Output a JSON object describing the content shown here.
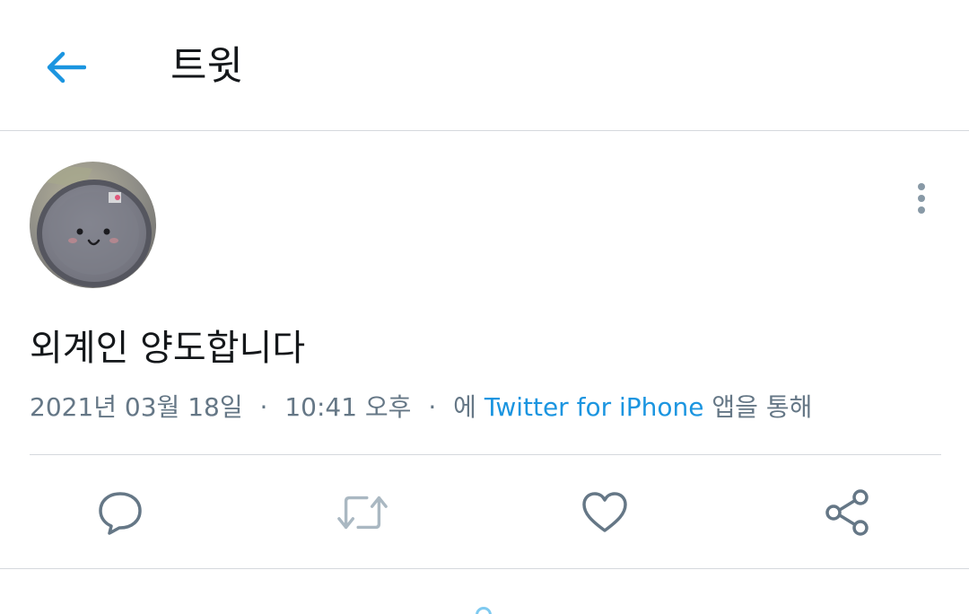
{
  "header": {
    "title": "트윗",
    "back_icon": "arrow-left-icon"
  },
  "author": {
    "avatar": "profile-avatar",
    "more_icon": "vertical-dots-icon"
  },
  "tweet": {
    "text": "외계인 양도합니다",
    "date": "2021년 03월 18일",
    "time": "10:41 오후",
    "source_prefix": "에",
    "source": "Twitter for iPhone",
    "source_suffix": "앱을 통해",
    "separator": "·"
  },
  "actions": {
    "reply_icon": "reply-bubble-icon",
    "retweet_icon": "retweet-icon",
    "like_icon": "heart-icon",
    "share_icon": "share-icon"
  },
  "colors": {
    "accent": "#1b95e0",
    "text_primary": "#14171a",
    "text_secondary": "#657786",
    "divider": "#d5d9dd",
    "icon": "#657786",
    "icon_disabled": "#aab8c2"
  }
}
